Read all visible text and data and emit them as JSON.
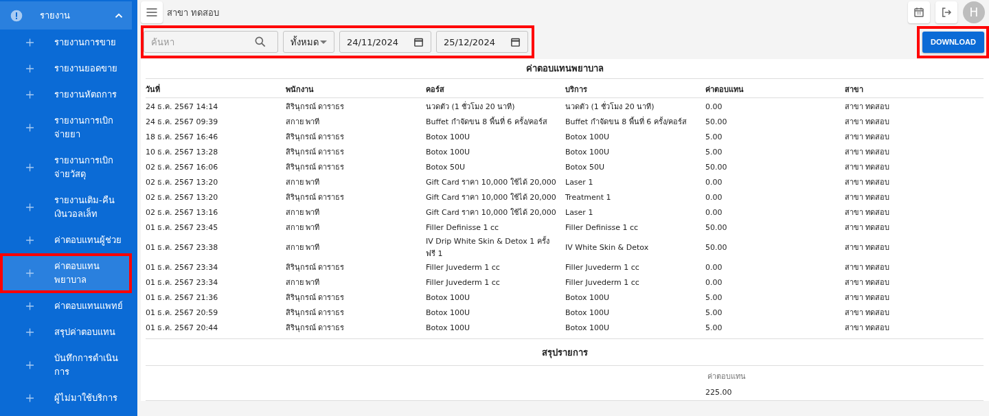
{
  "topbar": {
    "branch": "สาขา ทดสอบ",
    "avatar": "H"
  },
  "sidebar": {
    "group": {
      "label": "รายงาน",
      "expanded": true,
      "selected": true
    },
    "items": [
      {
        "label": "รายงานการขาย",
        "selected": false,
        "highlighted": false
      },
      {
        "label": "รายงานยอดขาย",
        "selected": false,
        "highlighted": false
      },
      {
        "label": "รายงานหัตถการ",
        "selected": false,
        "highlighted": false
      },
      {
        "label": "รายงานการเบิกจ่ายยา",
        "selected": false,
        "highlighted": false
      },
      {
        "label": "รายงานการเบิกจ่ายวัสดุ",
        "selected": false,
        "highlighted": false
      },
      {
        "label": "รายงานเติม-คืนเงินวอลเล็ท",
        "selected": false,
        "highlighted": false
      },
      {
        "label": "ค่าตอบแทนผู้ช่วย",
        "selected": false,
        "highlighted": false
      },
      {
        "label": "ค่าตอบแทนพยาบาล",
        "selected": true,
        "highlighted": true
      },
      {
        "label": "ค่าตอบแทนแพทย์",
        "selected": false,
        "highlighted": false
      },
      {
        "label": "สรุปค่าตอบแทน",
        "selected": false,
        "highlighted": false
      },
      {
        "label": "บันทึกการดำเนินการ",
        "selected": false,
        "highlighted": false
      },
      {
        "label": "ผู้ไม่มาใช้บริการ",
        "selected": false,
        "highlighted": false
      }
    ]
  },
  "filters": {
    "highlighted": true,
    "search": {
      "placeholder": "ค้นหา"
    },
    "type_select": {
      "value": "ทั้งหมด"
    },
    "date_from": "24/11/2024",
    "date_to": "25/12/2024"
  },
  "download": {
    "label": "DOWNLOAD",
    "highlighted": true
  },
  "report": {
    "title": "ค่าตอบแทนพยาบาล",
    "columns": [
      "วันที่",
      "พนักงาน",
      "คอร์ส",
      "บริการ",
      "ค่าตอบแทน",
      "สาขา"
    ],
    "rows": [
      [
        "24 ธ.ค. 2567 14:14",
        "สิรินุกรณ์ ดาราธร",
        "นวดตัว (1 ชั่วโมง 20 นาที)",
        "นวดตัว (1 ชั่วโมง 20 นาที)",
        "0.00",
        "สาขา ทดสอบ"
      ],
      [
        "24 ธ.ค. 2567 09:39",
        "สกาย พาที",
        "Buffet กำจัดขน 8 พื้นที่ 6 ครั้ง/คอร์ส",
        "Buffet กำจัดขน 8 พื้นที่ 6 ครั้ง/คอร์ส",
        "50.00",
        "สาขา ทดสอบ"
      ],
      [
        "18 ธ.ค. 2567 16:46",
        "สิรินุกรณ์ ดาราธร",
        "Botox 100U",
        "Botox 100U",
        "5.00",
        "สาขา ทดสอบ"
      ],
      [
        "10 ธ.ค. 2567 13:28",
        "สิรินุกรณ์ ดาราธร",
        "Botox 100U",
        "Botox 100U",
        "5.00",
        "สาขา ทดสอบ"
      ],
      [
        "02 ธ.ค. 2567 16:06",
        "สิรินุกรณ์ ดาราธร",
        "Botox 50U",
        "Botox 50U",
        "50.00",
        "สาขา ทดสอบ"
      ],
      [
        "02 ธ.ค. 2567 13:20",
        "สกาย พาที",
        "Gift Card ราคา 10,000 ใช้ได้ 20,000",
        "Laser 1",
        "0.00",
        "สาขา ทดสอบ"
      ],
      [
        "02 ธ.ค. 2567 13:20",
        "สิรินุกรณ์ ดาราธร",
        "Gift Card ราคา 10,000 ใช้ได้ 20,000",
        "Treatment 1",
        "0.00",
        "สาขา ทดสอบ"
      ],
      [
        "02 ธ.ค. 2567 13:16",
        "สกาย พาที",
        "Gift Card ราคา 10,000 ใช้ได้ 20,000",
        "Laser 1",
        "0.00",
        "สาขา ทดสอบ"
      ],
      [
        "01 ธ.ค. 2567 23:45",
        "สกาย พาที",
        "Filler Definisse 1 cc",
        "Filler Definisse 1 cc",
        "50.00",
        "สาขา ทดสอบ"
      ],
      [
        "01 ธ.ค. 2567 23:38",
        "สกาย พาที",
        "IV Drip White Skin & Detox 1 ครั้ง ฟรี 1",
        "IV White Skin & Detox",
        "50.00",
        "สาขา ทดสอบ"
      ],
      [
        "01 ธ.ค. 2567 23:34",
        "สิรินุกรณ์ ดาราธร",
        "Filler Juvederm 1 cc",
        "Filler Juvederm 1 cc",
        "0.00",
        "สาขา ทดสอบ"
      ],
      [
        "01 ธ.ค. 2567 23:34",
        "สกาย พาที",
        "Filler Juvederm 1 cc",
        "Filler Juvederm 1 cc",
        "0.00",
        "สาขา ทดสอบ"
      ],
      [
        "01 ธ.ค. 2567 21:36",
        "สิรินุกรณ์ ดาราธร",
        "Botox 100U",
        "Botox 100U",
        "5.00",
        "สาขา ทดสอบ"
      ],
      [
        "01 ธ.ค. 2567 20:59",
        "สิรินุกรณ์ ดาราธร",
        "Botox 100U",
        "Botox 100U",
        "5.00",
        "สาขา ทดสอบ"
      ],
      [
        "01 ธ.ค. 2567 20:44",
        "สิรินุกรณ์ ดาราธร",
        "Botox 100U",
        "Botox 100U",
        "5.00",
        "สาขา ทดสอบ"
      ]
    ]
  },
  "summary": {
    "title": "สรุปรายการ",
    "label": "ค่าตอบแทน",
    "value": "225.00"
  }
}
